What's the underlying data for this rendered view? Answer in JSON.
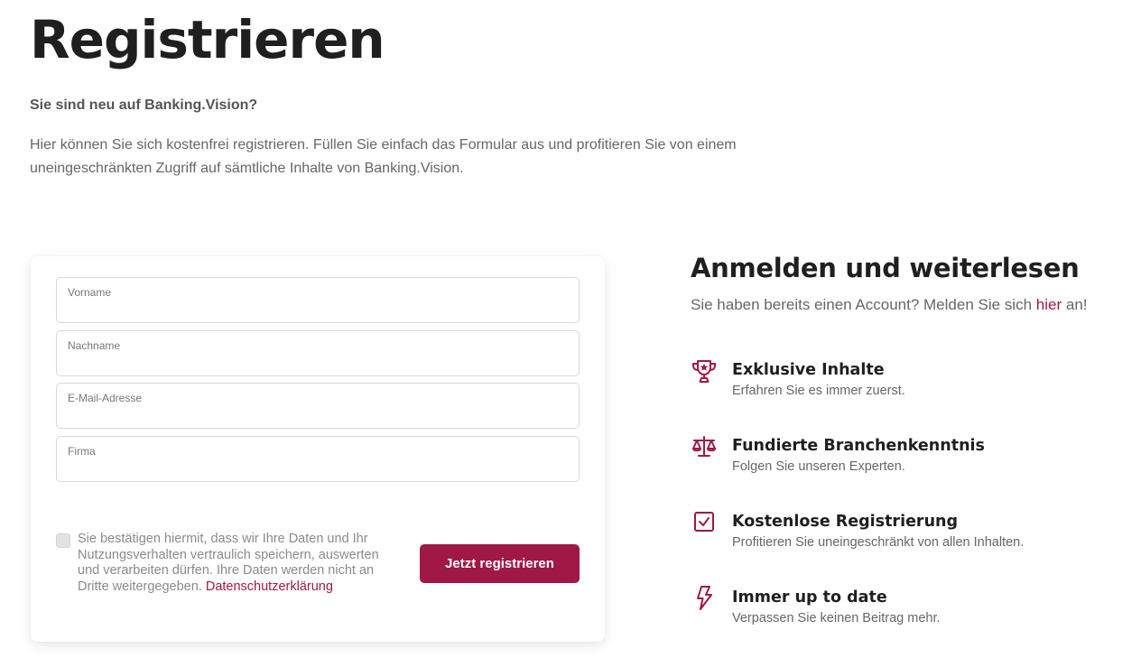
{
  "header": {
    "title": "Registrieren",
    "subtitle": "Sie sind neu auf Banking.Vision?",
    "intro": "Hier können Sie sich kostenfrei registrieren. Füllen Sie einfach das Formular aus und profitieren Sie von einem uneingeschränkten Zugriff auf sämtliche Inhalte von Banking.Vision."
  },
  "form": {
    "fields": [
      {
        "label": "Vorname",
        "value": ""
      },
      {
        "label": "Nachname",
        "value": ""
      },
      {
        "label": "E-Mail-Adresse",
        "value": ""
      },
      {
        "label": "Firma",
        "value": ""
      }
    ],
    "consent_text": "Sie bestätigen hiermit, dass wir Ihre Daten und Ihr Nutzungsverhalten vertraulich speichern, auswerten und verarbeiten dürfen. Ihre Daten werden nicht an Dritte weitergegeben.",
    "consent_checked": false,
    "privacy_link": "Datenschutzerklärung",
    "submit_label": "Jetzt registrieren"
  },
  "sidebar": {
    "title": "Anmelden und weiterlesen",
    "login_prefix": "Sie haben bereits einen Account? Melden Sie sich",
    "login_link": "hier",
    "login_suffix": "an!",
    "features": [
      {
        "icon": "trophy-icon",
        "title": "Exklusive Inhalte",
        "desc": "Erfahren Sie es immer zuerst."
      },
      {
        "icon": "scale-icon",
        "title": "Fundierte Branchenkenntnis",
        "desc": "Folgen Sie unseren Experten."
      },
      {
        "icon": "checkbox-icon",
        "title": "Kostenlose Registrierung",
        "desc": "Profitieren Sie uneingeschränkt von allen Inhalten."
      },
      {
        "icon": "lightning-icon",
        "title": "Immer up to date",
        "desc": "Verpassen Sie keinen Beitrag mehr."
      }
    ]
  },
  "colors": {
    "accent": "#a01846",
    "heading": "#1f1f1f",
    "text": "#666666"
  }
}
